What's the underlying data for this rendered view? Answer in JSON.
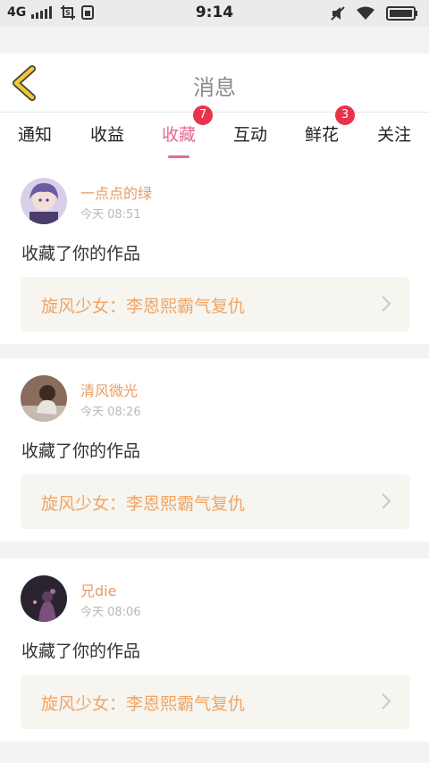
{
  "status_bar": {
    "network": "4G",
    "time": "9:14",
    "icons": [
      "signal-bars-icon",
      "screenshot-icon",
      "sim-icon",
      "mute-icon",
      "wifi-icon",
      "battery-icon"
    ]
  },
  "header": {
    "title": "消息",
    "back_icon": "chevron-left-icon"
  },
  "tabs": [
    {
      "label": "通知",
      "badge": "",
      "active": false
    },
    {
      "label": "收益",
      "badge": "",
      "active": false
    },
    {
      "label": "收藏",
      "badge": "7",
      "active": true
    },
    {
      "label": "互动",
      "badge": "",
      "active": false
    },
    {
      "label": "鲜花",
      "badge": "3",
      "active": false
    },
    {
      "label": "关注",
      "badge": "",
      "active": false
    }
  ],
  "messages": [
    {
      "username": "一点点的绿",
      "time": "今天 08:51",
      "text": "收藏了你的作品",
      "work_title": "旋风少女：李恩熙霸气复仇"
    },
    {
      "username": "清风微光",
      "time": "今天 08:26",
      "text": "收藏了你的作品",
      "work_title": "旋风少女：李恩熙霸气复仇"
    },
    {
      "username": "兄die",
      "time": "今天 08:06",
      "text": "收藏了你的作品",
      "work_title": "旋风少女：李恩熙霸气复仇"
    }
  ],
  "colors": {
    "accent": "#e36a97",
    "badge": "#e8344a",
    "username": "#e99b62",
    "work_title": "#f0a565",
    "back_icon": "#f3c832"
  }
}
